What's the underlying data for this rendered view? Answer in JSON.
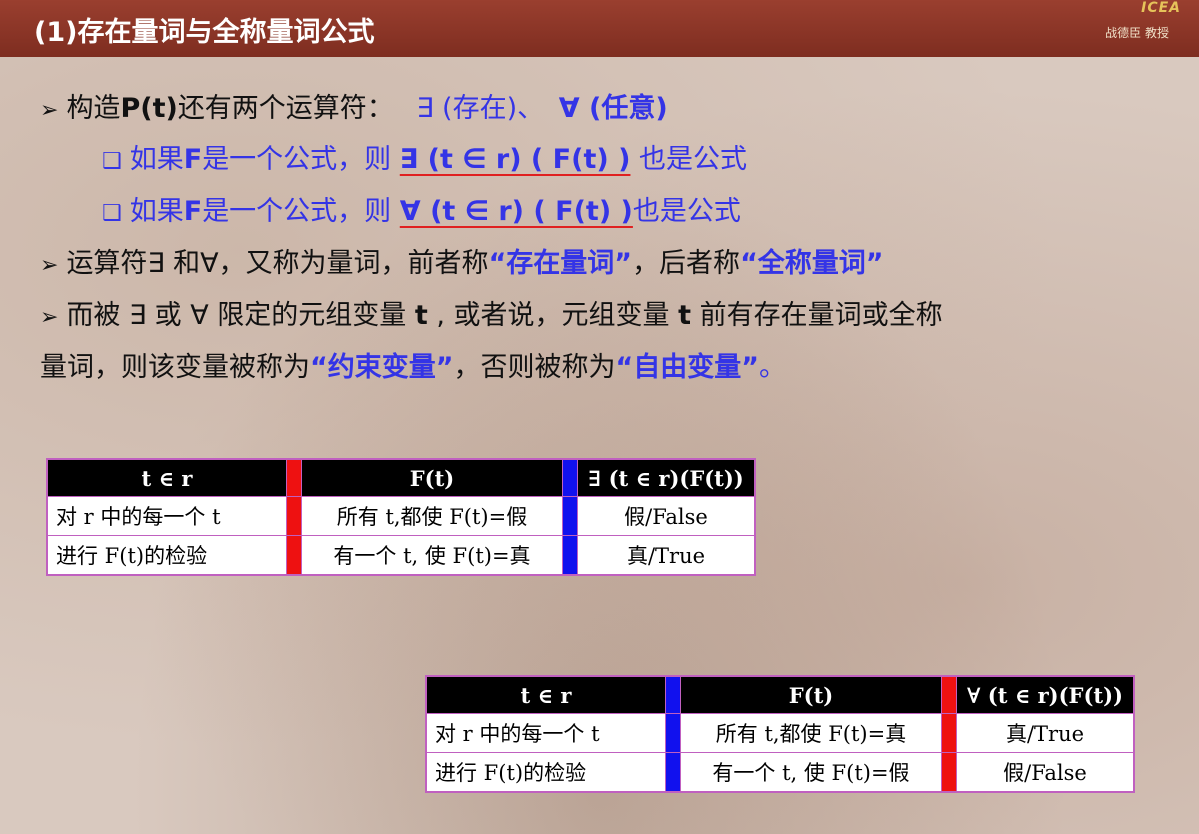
{
  "header": {
    "title": "(1)存在量词与全称量词公式",
    "logo_text": "ICEA",
    "author": "战德臣 教授"
  },
  "lines": {
    "l1_prefix": "构造",
    "l1_pt": "P(t)",
    "l1_mid": "还有两个运算符：",
    "l1_exists": "∃ (存在)",
    "l1_sep": "、",
    "l1_forall": "∀ (任意)",
    "l2_prefix": "如果",
    "l2_f": "F",
    "l2_mid": "是一个公式，则",
    "l2_formula": "∃ (t ∈ r) ( F(t) )",
    "l2_suffix": " 也是公式",
    "l3_prefix": "如果",
    "l3_f": "F",
    "l3_mid": "是一个公式，则",
    "l3_formula": "∀ (t ∈ r) ( F(t) )",
    "l3_suffix": "也是公式",
    "l4_a": "运算符∃ 和∀，又称为量词，前者称",
    "l4_exist_q": "“存在量词”",
    "l4_b": "，后者称",
    "l4_all_q": "“全称量词”",
    "l5_a": "而被 ∃ 或 ∀ 限定的元组变量 ",
    "l5_t1": "t",
    "l5_b": " , 或者说，元组变量 ",
    "l5_t2": "t",
    "l5_c": " 前有存在量词或全称",
    "l6_a": "量词，则该变量被称为",
    "l6_bound": "“约束变量”",
    "l6_b": "，否则被称为",
    "l6_free": "“自由变量”",
    "l6_end": "。"
  },
  "table1": {
    "headers": [
      "t ∈ r",
      "F(t)",
      "∃ (t ∈ r)(F(t))"
    ],
    "row1": [
      "对 r 中的每一个 t",
      "所有 t,都使 F(t)=假",
      "假/False"
    ],
    "row2": [
      "进行 F(t)的检验",
      "有一个 t, 使 F(t)=真",
      "真/True"
    ]
  },
  "table2": {
    "headers": [
      "t ∈ r",
      "F(t)",
      "∀ (t ∈ r)(F(t))"
    ],
    "row1": [
      "对 r 中的每一个 t",
      "所有 t,都使 F(t)=真",
      "真/True"
    ],
    "row2": [
      "进行 F(t)的检验",
      "有一个 t, 使 F(t)=假",
      "假/False"
    ]
  },
  "colors": {
    "accent_blue": "#3434e6",
    "header_bg": "#8a3526",
    "sep_red": "#ee1111",
    "sep_blue": "#1111ee"
  }
}
